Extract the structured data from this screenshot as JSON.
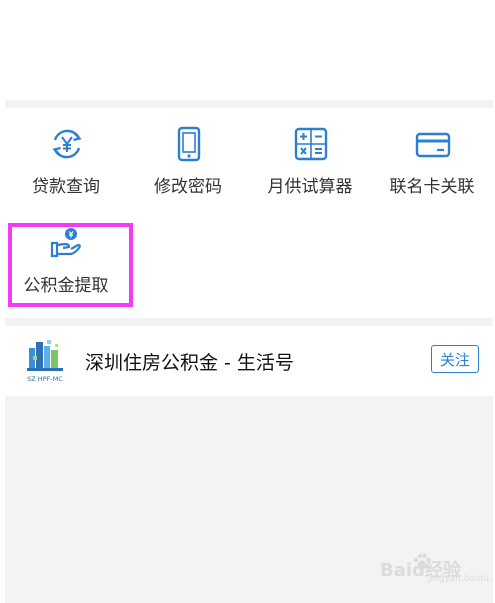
{
  "services": [
    {
      "label": "贷款查询",
      "icon": "yen-refresh-icon"
    },
    {
      "label": "修改密码",
      "icon": "phone-icon"
    },
    {
      "label": "月供试算器",
      "icon": "calculator-icon"
    },
    {
      "label": "联名卡关联",
      "icon": "card-icon"
    },
    {
      "label": "公积金提取",
      "icon": "hand-coin-icon"
    }
  ],
  "account": {
    "name": "深圳住房公积金 - 生活号",
    "follow_label": "关注",
    "logo_text": "SZ HPF-MC"
  },
  "watermark": {
    "text": "Baid经验",
    "sub": "jingyan.baidu.com"
  },
  "colors": {
    "accent": "#2d7fd0",
    "highlight": "#f23bf2",
    "background_gray": "#f2f3f5"
  }
}
